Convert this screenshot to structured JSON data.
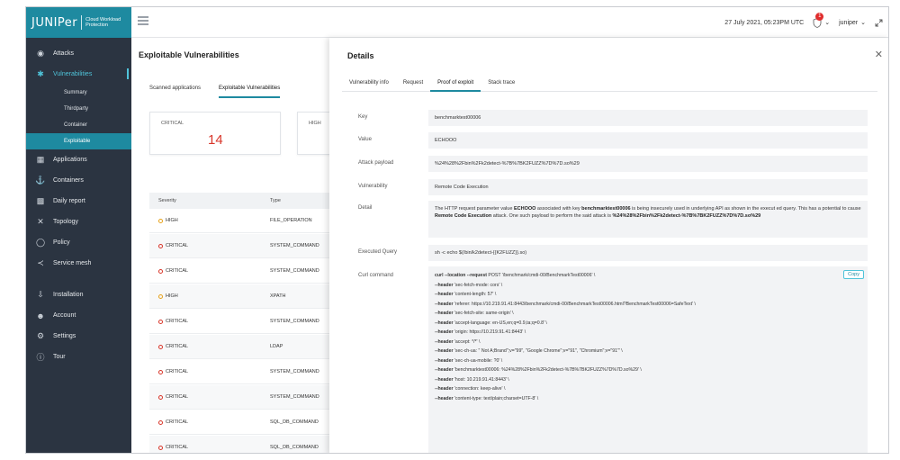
{
  "brand": {
    "logo": "JUNIPer",
    "product": "Cloud Workload Protection"
  },
  "topbar": {
    "datetime": "27 July 2021, 05:23PM UTC",
    "alert_count": "1",
    "user": "juniper"
  },
  "sidebar": {
    "items_top": [
      {
        "label": "Attacks",
        "icon": "eye-icon"
      },
      {
        "label": "Vulnerabilities",
        "icon": "bug-icon"
      }
    ],
    "sub_items": [
      "Summary",
      "Thirdparty",
      "Container",
      "Exploitable"
    ],
    "items_mid": [
      {
        "label": "Applications",
        "icon": "grid-icon"
      },
      {
        "label": "Containers",
        "icon": "ship-icon"
      },
      {
        "label": "Daily report",
        "icon": "chart-icon"
      },
      {
        "label": "Topology",
        "icon": "cross-icon"
      },
      {
        "label": "Policy",
        "icon": "shield-icon"
      },
      {
        "label": "Service mesh",
        "icon": "mesh-icon"
      }
    ],
    "items_bottom": [
      {
        "label": "Installation",
        "icon": "install-icon"
      },
      {
        "label": "Account",
        "icon": "user-icon"
      },
      {
        "label": "Settings",
        "icon": "gear-icon"
      },
      {
        "label": "Tour",
        "icon": "info-icon"
      }
    ]
  },
  "main": {
    "title": "Exploitable Vulnerabilities",
    "tabs": [
      "Scanned applications",
      "Exploitable Vulnerabilities"
    ],
    "cards": [
      {
        "label": "CRITICAL",
        "value": "14"
      },
      {
        "label": "HIGH",
        "value": ""
      }
    ],
    "table": {
      "headers": [
        "Severity",
        "Type"
      ],
      "rows": [
        {
          "severity": "HIGH",
          "type": "FILE_OPERATION"
        },
        {
          "severity": "CRITICAL",
          "type": "SYSTEM_COMMAND"
        },
        {
          "severity": "CRITICAL",
          "type": "SYSTEM_COMMAND"
        },
        {
          "severity": "HIGH",
          "type": "XPATH"
        },
        {
          "severity": "CRITICAL",
          "type": "SYSTEM_COMMAND"
        },
        {
          "severity": "CRITICAL",
          "type": "LDAP"
        },
        {
          "severity": "CRITICAL",
          "type": "SYSTEM_COMMAND"
        },
        {
          "severity": "CRITICAL",
          "type": "SYSTEM_COMMAND"
        },
        {
          "severity": "CRITICAL",
          "type": "SQL_DB_COMMAND"
        },
        {
          "severity": "CRITICAL",
          "type": "SQL_DB_COMMAND"
        }
      ]
    }
  },
  "details": {
    "title": "Details",
    "tabs": [
      "Vulnerability info",
      "Request",
      "Proof of exploit",
      "Stack trace"
    ],
    "fields": {
      "key": {
        "label": "Key",
        "value": "benchmarktest00006"
      },
      "value": {
        "label": "Value",
        "value": "ECHOOO"
      },
      "attack_payload": {
        "label": "Attack payload",
        "value": "%24%28%2Fbin%2Fk2detect-%7B%7BK2FUZZ%7D%7D.so%29"
      },
      "vulnerability": {
        "label": "Vulnerability",
        "value": "Remote Code Execution"
      },
      "detail": {
        "label": "Detail",
        "p1": "The HTTP request parameter value ",
        "b1": "ECHOOO",
        "p2": " associated with key ",
        "b2": "benchmarktest00006",
        "p3": " is being insecurely used in underlying API as shown in the execut ed query. This has a potential to cause ",
        "b3": "Remote Code Execution",
        "p4": " attack. One such payload to perform the said attack is ",
        "b4": "%24%28%2Fbin%2Fk2detect-%7B%7BK2FUZZ%7D%7D.so%29"
      },
      "executed_query": {
        "label": "Executed Query",
        "value": "sh -c echo $(/bin/k2detect-{{K2FUZZ}}.so)"
      },
      "curl": {
        "label": "Curl command",
        "copy_label": "Copy",
        "lines": [
          {
            "flag": "curl --location --request",
            "text": " POST '/benchmark/cmdi-00/BenchmarkTest00006' \\"
          },
          {
            "flag": "--header",
            "text": " 'sec-fetch-mode: cors' \\"
          },
          {
            "flag": "--header",
            "text": " 'content-length: 57' \\"
          },
          {
            "flag": "--header",
            "text": " 'referer: https://10.219.91.41:8443/benchmark/cmdi-00/BenchmarkTest00006.html?BenchmarkTest00006=SafeText' \\"
          },
          {
            "flag": "--header",
            "text": " 'sec-fetch-site: same-origin' \\"
          },
          {
            "flag": "--header",
            "text": " 'accept-language: en-US,en;q=0.9,ta;q=0.8' \\"
          },
          {
            "flag": "--header",
            "text": " 'origin: https://10.219.91.41:8443' \\"
          },
          {
            "flag": "--header",
            "text": " 'accept: */*' \\"
          },
          {
            "flag": "--header",
            "text": " 'sec-ch-ua: \" Not A;Brand\";v=\"99\", \"Google Chrome\";v=\"91\", \"Chromium\";v=\"91\"' \\"
          },
          {
            "flag": "--header",
            "text": " 'sec-ch-ua-mobile: ?0' \\"
          },
          {
            "flag": "--header",
            "text": " 'benchmarktest00006: %24%28%2Fbin%2Fk2detect-%7B%7BK2FUZZ%7D%7D.so%29' \\"
          },
          {
            "flag": "--header",
            "text": " 'host: 10.219.91.41:8443' \\"
          },
          {
            "flag": "--header",
            "text": " 'connection: keep-alive' \\"
          },
          {
            "flag": "--header",
            "text": " 'content-type: text/plain;charset=UTF-8' \\"
          }
        ]
      }
    }
  }
}
